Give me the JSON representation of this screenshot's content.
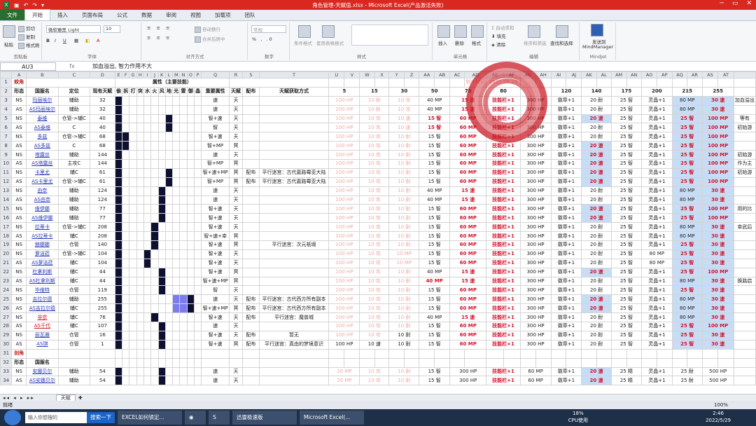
{
  "window": {
    "title": "角色管理-天賦值.xlsx - Microsoft Excel(产品激活失败)",
    "controls": [
      "─",
      "▭",
      "✕"
    ]
  },
  "ribbon_tabs": [
    "文件",
    "开始",
    "插入",
    "页面布局",
    "公式",
    "数据",
    "审阅",
    "视图",
    "加载项",
    "团队"
  ],
  "ribbon": {
    "paste": "粘贴",
    "cut": "剪切",
    "copy": "复制",
    "painter": "格式刷",
    "clipboard": "剪贴板",
    "font_name": "微软雅黑 Light",
    "font_size": "10",
    "font_group": "字体",
    "wrap": "自动换行",
    "merge": "合并后居中",
    "align_group": "对齐方式",
    "number_format": "常规",
    "number_group": "数字",
    "cond": "条件格式",
    "table_fmt": "套用表格格式",
    "styles_group": "样式",
    "insert": "插入",
    "delete": "删除",
    "format": "格式",
    "cells_group": "单元格",
    "autosum": "自动求和",
    "fill": "填充",
    "clear": "清除",
    "sort": "排序和筛选",
    "find": "查找和选择",
    "edit_group": "编辑",
    "mm_send": "发送到",
    "mm_name": "MindManager",
    "mm_group": "Mindjet"
  },
  "formula_bar": {
    "cell": "AU3",
    "fx": "fx",
    "formula": "加血溢出, 智力作用不大"
  },
  "col_headers": [
    "A",
    "B",
    "C",
    "D",
    "E",
    "F",
    "G",
    "H",
    "I",
    "J",
    "K",
    "L",
    "M",
    "N",
    "O",
    "P",
    "Q",
    "R",
    "S",
    "T",
    "U",
    "V",
    "W",
    "X",
    "Y",
    "Z",
    "AA",
    "AB",
    "AC",
    "AD",
    "AE",
    "AF",
    "AG",
    "AH",
    "AI",
    "AJ",
    "AK",
    "AL",
    "AM",
    "AN",
    "AO",
    "AP",
    "AQ",
    "AR",
    "AS",
    "AT"
  ],
  "title_row": {
    "A": "蛟角",
    "E": "属性（主要技能）",
    "AD": "制作时间",
    "AE": "2022-05-29"
  },
  "header_row": {
    "A": "形态",
    "B": "国服名",
    "C": "定位",
    "D": "现有天赋",
    "E": "偷",
    "F": "拆",
    "G": "打",
    "H": "突",
    "I": "水",
    "J": "火",
    "K": "风",
    "L": "地",
    "M": "光",
    "N": "雷",
    "O": "御",
    "P": "晶",
    "Q": "重要属性",
    "R": "天赋",
    "S": "配布",
    "T": "天赋获取方式",
    "levels": [
      "5",
      "15",
      "30",
      "50",
      "75",
      "80",
      "",
      "120",
      "140",
      "175",
      "200",
      "215",
      "255"
    ]
  },
  "rows": [
    {
      "n": "3",
      "a": "NS",
      "b": "玛丽埃尔",
      "c": "辅助",
      "d": "32",
      "q": "速",
      "r": "天",
      "s": "",
      "t": "",
      "bk": [
        "E"
      ],
      "lv": [
        "100 HP",
        "10 耐",
        "10 攻",
        "40 MP",
        "15 速",
        "技能栏+1",
        "300 HP",
        "徽章+1",
        "20 耐",
        "25 智",
        "灵晶+1",
        "80 MP",
        "30 速"
      ],
      "note": "加血溢出"
    },
    {
      "n": "4",
      "a": "AS",
      "b": "AS玛丽埃尔",
      "c": "辅助",
      "d": "32",
      "q": "速",
      "r": "天",
      "s": "",
      "t": "",
      "bk": [
        "E"
      ],
      "lv": [
        "100 HP",
        "10 耐",
        "10 攻",
        "40 MP",
        "15 速",
        "技能栏+1",
        "300 HP",
        "徽章+1",
        "20 耐",
        "25 智",
        "灵晶+1",
        "80 MP",
        "30 速"
      ],
      "note": ""
    },
    {
      "n": "5",
      "a": "NS",
      "b": "泰维",
      "c": "仓管->辅C",
      "d": "40",
      "q": "智+速",
      "r": "天",
      "s": "",
      "t": "",
      "bk": [
        "E",
        "L"
      ],
      "lv": [
        "100 HP",
        "10 攻",
        "10 速",
        "15 智",
        "60 MP",
        "技能栏+1",
        "300 HP",
        "徽章+1",
        "20 速",
        "25 智",
        "灵晶+1",
        "25 智",
        "100 MP"
      ],
      "note": "等有"
    },
    {
      "n": "6",
      "a": "AS",
      "b": "AS泰维",
      "c": "C",
      "d": "40",
      "q": "智",
      "r": "天",
      "s": "",
      "t": "",
      "bk": [
        "E",
        "L"
      ],
      "lv": [
        "100 HP",
        "10 攻",
        "10 速",
        "15 智",
        "60 MP",
        "技能栏+1",
        "300 HP",
        "徽章+1",
        "20 耐",
        "25 智",
        "灵晶+1",
        "25 智",
        "100 MP"
      ],
      "note": "初始游"
    },
    {
      "n": "7",
      "a": "NS",
      "b": "多兹",
      "c": "仓管->辅C",
      "d": "68",
      "q": "智+速",
      "r": "天",
      "s": "",
      "t": "",
      "bk": [
        "E",
        "F"
      ],
      "lv": [
        "100 HP",
        "10 攻",
        "10 耐",
        "15 智",
        "60 MP",
        "技能栏+1",
        "300 HP",
        "徽章+1",
        "20 耐",
        "25 智",
        "灵晶+1",
        "25 智",
        "100 MP"
      ],
      "note": ""
    },
    {
      "n": "8",
      "a": "AS",
      "b": "AS多兹",
      "c": "C",
      "d": "68",
      "q": "智+MP",
      "r": "冥",
      "s": "",
      "t": "",
      "bk": [
        "E",
        "F"
      ],
      "lv": [
        "100 HP",
        "10 攻",
        "10 耐",
        "15 智",
        "60 MP",
        "技能栏+1",
        "300 HP",
        "徽章+1",
        "20 速",
        "25 智",
        "灵晶+1",
        "25 智",
        "100 MP"
      ],
      "note": ""
    },
    {
      "n": "9",
      "a": "NS",
      "b": "塔露丝",
      "c": "辅助",
      "d": "144",
      "q": "速",
      "r": "天",
      "s": "",
      "t": "",
      "bk": [
        "E"
      ],
      "lv": [
        "100 HP",
        "10 攻",
        "10 耐",
        "15 智",
        "60 MP",
        "技能栏+1",
        "300 HP",
        "徽章+1",
        "20 速",
        "25 智",
        "灵晶+1",
        "25 智",
        "100 MP"
      ],
      "note": "初始游"
    },
    {
      "n": "10",
      "a": "AS",
      "b": "AS塔露丝",
      "c": "主攻C",
      "d": "144",
      "q": "智+MP",
      "r": "冥",
      "s": "",
      "t": "",
      "bk": [
        "E"
      ],
      "lv": [
        "100 HP",
        "10 攻",
        "10 耐",
        "15 智",
        "60 MP",
        "技能栏+1",
        "300 HP",
        "徽章+1",
        "20 速",
        "25 智",
        "灵晶+1",
        "25 智",
        "100 MP"
      ],
      "note": "作为主"
    },
    {
      "n": "11",
      "a": "NS",
      "b": "卡里尤",
      "c": "辅C",
      "d": "61",
      "q": "智+速+MP",
      "r": "冥",
      "s": "配布",
      "t": "平行迷宫：古代嘉路霉亚大陆",
      "bk": [
        "E",
        "L"
      ],
      "lv": [
        "100 HP",
        "10 攻",
        "10 耐",
        "15 智",
        "60 MP",
        "技能栏+1",
        "300 HP",
        "徽章+1",
        "20 速",
        "25 智",
        "灵晶+1",
        "25 智",
        "100 MP"
      ],
      "note": "初始游"
    },
    {
      "n": "12",
      "a": "AS",
      "b": "AS卡里尤",
      "c": "仓管->辅C",
      "d": "61",
      "q": "智+MP",
      "r": "冥",
      "s": "配布",
      "t": "平行迷宫：古代嘉路霉亚大陆",
      "bk": [
        "E",
        "L"
      ],
      "lv": [
        "100 HP",
        "10 攻",
        "10 耐",
        "15 智",
        "60 MP",
        "技能栏+1",
        "300 HP",
        "徽章+1",
        "20 速",
        "25 智",
        "灵晶+1",
        "25 智",
        "100 MP"
      ],
      "note": ""
    },
    {
      "n": "13",
      "a": "NS",
      "b": "由奈",
      "c": "辅助",
      "d": "124",
      "q": "速",
      "r": "天",
      "s": "",
      "t": "",
      "bk": [
        "E",
        "K"
      ],
      "lv": [
        "100 HP",
        "10 攻",
        "10 耐",
        "40 MP",
        "15 速",
        "技能栏+1",
        "300 HP",
        "徽章+1",
        "20 耐",
        "25 智",
        "灵晶+1",
        "80 MP",
        "30 速"
      ],
      "note": ""
    },
    {
      "n": "14",
      "a": "AS",
      "b": "AS由奈",
      "c": "辅助",
      "d": "124",
      "q": "速",
      "r": "天",
      "s": "",
      "t": "",
      "bk": [
        "E",
        "K"
      ],
      "lv": [
        "100 HP",
        "10 攻",
        "10 耐",
        "40 MP",
        "15 速",
        "技能栏+1",
        "300 HP",
        "徽章+1",
        "20 耐",
        "25 智",
        "灵晶+1",
        "80 MP",
        "30 速"
      ],
      "note": ""
    },
    {
      "n": "15",
      "a": "NS",
      "b": "维伊娜",
      "c": "辅助",
      "d": "77",
      "q": "智+速",
      "r": "天",
      "s": "",
      "t": "",
      "bk": [
        "E",
        "K"
      ],
      "lv": [
        "100 HP",
        "10 攻",
        "10 耐",
        "15 智",
        "60 MP",
        "技能栏+1",
        "300 HP",
        "徽章+1",
        "20 速",
        "25 智",
        "灵晶+1",
        "25 智",
        "100 MP"
      ],
      "note": "用的比"
    },
    {
      "n": "16",
      "a": "AS",
      "b": "AS维伊娜",
      "c": "辅助",
      "d": "77",
      "q": "智+速",
      "r": "天",
      "s": "",
      "t": "",
      "bk": [
        "E",
        "K"
      ],
      "lv": [
        "100 HP",
        "10 攻",
        "10 耐",
        "15 智",
        "60 MP",
        "技能栏+1",
        "300 HP",
        "徽章+1",
        "20 速",
        "25 智",
        "灵晶+1",
        "25 智",
        "100 MP"
      ],
      "note": ""
    },
    {
      "n": "17",
      "a": "NS",
      "b": "拉蒂卡",
      "c": "仓管->辅C",
      "d": "208",
      "q": "智+速",
      "r": "天",
      "s": "",
      "t": "",
      "bk": [
        "E",
        "J"
      ],
      "lv": [
        "100 HP",
        "10 攻",
        "10 耐",
        "15 智",
        "60 MP",
        "技能栏+1",
        "300 HP",
        "徽章+1",
        "20 耐",
        "25 智",
        "灵晶+1",
        "80 MP",
        "30 速"
      ],
      "note": "幸武后"
    },
    {
      "n": "18",
      "a": "AS",
      "b": "AS拉蒂卡",
      "c": "辅C",
      "d": "208",
      "q": "智+速+幸",
      "r": "冥",
      "s": "",
      "t": "",
      "bk": [
        "E",
        "J"
      ],
      "lv": [
        "100 HP",
        "10 攻",
        "10 耐",
        "15 智",
        "60 MP",
        "技能栏+1",
        "300 HP",
        "徽章+1",
        "20 耐",
        "25 智",
        "灵晶+1",
        "80 MP",
        "30 速"
      ],
      "note": ""
    },
    {
      "n": "19",
      "a": "NS",
      "b": "赫娜娜",
      "c": "仓管",
      "d": "140",
      "q": "智+速",
      "r": "冥",
      "s": "",
      "t": "平行迷宫：次元祇堀",
      "bk": [
        "E",
        "J"
      ],
      "lv": [
        "100 HP",
        "10 攻",
        "10 耐",
        "15 智",
        "60 MP",
        "技能栏+1",
        "300 HP",
        "徽章+1",
        "20 耐",
        "25 智",
        "灵晶+1",
        "25 智",
        "30 速"
      ],
      "note": ""
    },
    {
      "n": "20",
      "a": "NS",
      "b": "萝洁菈",
      "c": "仓管->辅C",
      "d": "104",
      "q": "智+速",
      "r": "天",
      "s": "",
      "t": "",
      "bk": [
        "E",
        "I"
      ],
      "lv": [
        "100 HP",
        "10 攻",
        "10 MP",
        "15 智",
        "60 MP",
        "技能栏+1",
        "300 HP",
        "徽章+1",
        "20 耐",
        "25 智",
        "80 MP",
        "25 智",
        "30 速"
      ],
      "note": ""
    },
    {
      "n": "21",
      "a": "AS",
      "b": "AS萝洁菈",
      "c": "辅C",
      "d": "104",
      "q": "智+速",
      "r": "天",
      "s": "",
      "t": "",
      "bk": [
        "E",
        "I"
      ],
      "lv": [
        "100 HP",
        "10 攻",
        "10 MP",
        "15 智",
        "60 MP",
        "技能栏+1",
        "300 HP",
        "徽章+1",
        "20 耐",
        "25 智",
        "80 MP",
        "25 智",
        "30 速"
      ],
      "note": ""
    },
    {
      "n": "22",
      "a": "NS",
      "b": "杜拿利斯",
      "c": "辅C",
      "d": "44",
      "q": "智+速",
      "r": "冥",
      "s": "",
      "t": "",
      "bk": [
        "E",
        "K"
      ],
      "lv": [
        "100 HP",
        "10 攻",
        "10 耐",
        "40 MP",
        "15 速",
        "技能栏+1",
        "300 HP",
        "徽章+1",
        "20 速",
        "25 智",
        "灵晶+1",
        "25 智",
        "100 MP"
      ],
      "note": ""
    },
    {
      "n": "23",
      "a": "AS",
      "b": "AS杜拿利斯",
      "c": "辅C",
      "d": "44",
      "q": "智+速+MP",
      "r": "冥",
      "s": "",
      "t": "",
      "bk": [
        "E",
        "K"
      ],
      "lv": [
        "100 HP",
        "10 攻",
        "10 耐",
        "40 MP",
        "15 速",
        "技能栏+1",
        "300 HP",
        "徽章+1",
        "20 耐",
        "25 智",
        "灵晶+1",
        "80 MP",
        "30 速"
      ],
      "note": "换路启"
    },
    {
      "n": "24",
      "a": "NS",
      "b": "毕维特",
      "c": "仓管",
      "d": "119",
      "q": "智",
      "r": "天",
      "s": "",
      "t": "",
      "bk": [
        "E",
        "K"
      ],
      "lv": [
        "100 HP",
        "10 攻",
        "10 耐",
        "15 智",
        "60 MP",
        "技能栏+1",
        "300 HP",
        "徽章+1",
        "20 耐",
        "25 智",
        "灵晶+1",
        "25 智",
        "30 速"
      ],
      "note": ""
    },
    {
      "n": "25",
      "a": "NS",
      "b": "吉拉尔德",
      "c": "辅助",
      "d": "255",
      "q": "速",
      "r": "天",
      "s": "配布",
      "t": "平行迷宫：古代西方所有副本",
      "bk": [
        "E",
        "O"
      ],
      "bl": [
        "M",
        "N"
      ],
      "lv": [
        "100 HP",
        "10 攻",
        "10 耐",
        "15 智",
        "60 MP",
        "技能栏+1",
        "300 HP",
        "徽章+1",
        "20 速",
        "25 智",
        "灵晶+1",
        "80 MP",
        "30 速"
      ],
      "note": ""
    },
    {
      "n": "26",
      "a": "AS",
      "b": "AS吉拉尔德",
      "c": "辅C",
      "d": "255",
      "q": "智+速+MP",
      "r": "冥",
      "s": "配布",
      "t": "平行迷宫：古代西方所有副本",
      "bk": [
        "E",
        "O"
      ],
      "bl": [
        "M",
        "N"
      ],
      "lv": [
        "100 HP",
        "10 攻",
        "10 耐",
        "15 智",
        "60 MP",
        "技能栏+1",
        "300 HP",
        "徽章+1",
        "20 速",
        "25 智",
        "灵晶+1",
        "80 MP",
        "30 速"
      ],
      "note": ""
    },
    {
      "n": "27",
      "a": "NS",
      "b": "非奈",
      "c": "辅C",
      "d": "76",
      "q": "智+速",
      "r": "天",
      "s": "配布",
      "t": "平行迷宫：魔兽城",
      "bk": [
        "E",
        "J"
      ],
      "lv": [
        "100 HP",
        "10 攻",
        "10 耐",
        "40 MP",
        "15 速",
        "技能栏+1",
        "300 HP",
        "徽章+1",
        "20 耐",
        "25 智",
        "灵晶+1",
        "80 MP",
        "30 速"
      ],
      "note": ""
    },
    {
      "n": "28",
      "a": "AS",
      "b": "AS千代",
      "c": "辅C",
      "d": "107",
      "q": "速",
      "r": "天",
      "s": "",
      "t": "",
      "bk": [
        "E",
        "K"
      ],
      "lv": [
        "100 HP",
        "10 攻",
        "10 耐",
        "15 智",
        "60 MP",
        "技能栏+1",
        "300 HP",
        "徽章+1",
        "20 耐",
        "25 智",
        "灵晶+1",
        "25 智",
        "100 MP"
      ],
      "note": ""
    },
    {
      "n": "29",
      "a": "NS",
      "b": "丽瓦雅",
      "c": "仓管",
      "d": "16",
      "q": "智+速",
      "r": "天",
      "s": "配布",
      "t": "暂无",
      "bk": [
        "E",
        "K"
      ],
      "lv": [
        "100 HP",
        "10 攻",
        "10 耐",
        "15 智",
        "60 MP",
        "技能栏+1",
        "300 HP",
        "徽章+1",
        "20 耐",
        "25 智",
        "灵晶+1",
        "25 智",
        "30 速"
      ],
      "note": ""
    },
    {
      "n": "30",
      "a": "AS",
      "b": "AS琪",
      "c": "仓管",
      "d": "1",
      "q": "智+速",
      "r": "冥",
      "s": "配布",
      "t": "平行迷宫：真由的梦境意识",
      "bk": [
        "E",
        "K"
      ],
      "lv": [
        "100 HP",
        "10 速",
        "10 耐",
        "15 智",
        "60 MP",
        "技能栏+1",
        "300 HP",
        "徽章+1",
        "20 耐",
        "25 智",
        "灵晶+1",
        "25 智",
        "30 速"
      ],
      "note": ""
    },
    {
      "n": "31",
      "a": "剑角",
      "sec": true
    },
    {
      "n": "32",
      "a": "形态",
      "b": "国服名",
      "hdr": true
    },
    {
      "n": "33",
      "a": "NS",
      "b": "安娜贝尔",
      "c": "辅助",
      "d": "54",
      "q": "速",
      "r": "天",
      "s": "",
      "t": "",
      "bk": [
        "E",
        "K"
      ],
      "lv": [
        "20 MP",
        "10 攻",
        "10 耐",
        "15 智",
        "300 HP",
        "技能栏+1",
        "60 MP",
        "徽章+1",
        "20 速",
        "25 精",
        "灵晶+1",
        "25 耐",
        "500 HP"
      ],
      "note": ""
    },
    {
      "n": "34",
      "a": "AS",
      "b": "AS安娜贝尔",
      "c": "辅助",
      "d": "54",
      "q": "速",
      "r": "天",
      "s": "",
      "t": "",
      "bk": [
        "E",
        "K"
      ],
      "lv": [
        "20 MP",
        "10 攻",
        "10 耐",
        "15 智",
        "300 HP",
        "技能栏+1",
        "60 MP",
        "徽章+1",
        "20 速",
        "25 精",
        "灵晶+1",
        "25 耐",
        "500 HP"
      ],
      "note": ""
    }
  ],
  "sheet_tab": "天赋",
  "status": "就绪",
  "zoom": "100%",
  "taskbar": {
    "search_placeholder": "输入你想搜的",
    "search_btn": "搜索一下",
    "apps": [
      "EXCEL如何锁定...",
      "迅雷极速版",
      "Microsoft Excel(..."
    ],
    "cpu": "18%",
    "cpu_label": "CPU使用",
    "time": "2:46",
    "date": "2022/5/29"
  }
}
